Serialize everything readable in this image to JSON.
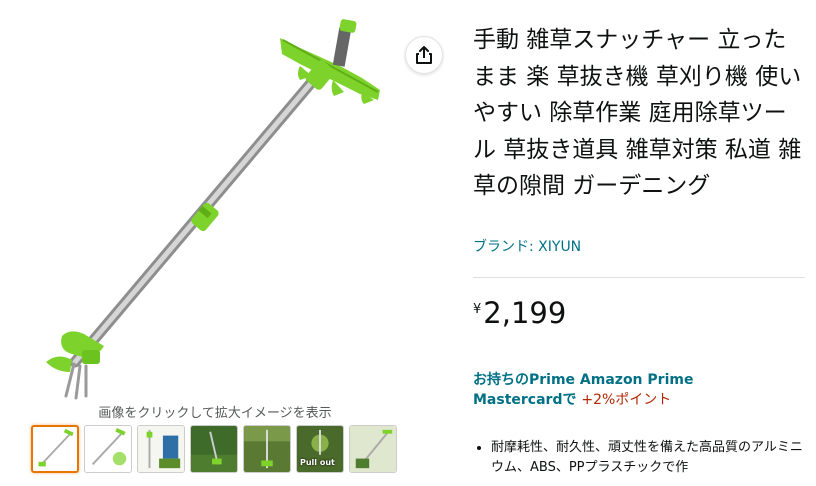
{
  "product": {
    "title": "手動 雑草スナッチャー 立ったまま 楽 草抜き機 草刈り機 使いやすい 除草作業 庭用除草ツール 草抜き道具 雑草対策 私道 雑草の隙間 ガーデニング",
    "brand_label": "ブランド: XIYUN",
    "price_symbol": "¥",
    "price_amount": "2,199"
  },
  "gallery": {
    "zoom_hint": "画像をクリックして拡大イメージを表示",
    "thumbnails": [
      {
        "label": ""
      },
      {
        "label": ""
      },
      {
        "label": ""
      },
      {
        "label": ""
      },
      {
        "label": ""
      },
      {
        "label": "Pull out"
      },
      {
        "label": ""
      }
    ]
  },
  "promo": {
    "card_text": "お持ちのPrime Amazon Prime Mastercardで",
    "points_text": "+2%ポイント"
  },
  "bullets": [
    "耐摩耗性、耐久性、頑丈性を備えた高品質のアルミニウム、ABS、PPプラスチックで作"
  ],
  "colors": {
    "link": "#007185",
    "price_accent": "#b12704",
    "tool_green": "#7dd32b",
    "selected_thumb": "#e77600"
  },
  "icons": {
    "share": "share-icon"
  }
}
